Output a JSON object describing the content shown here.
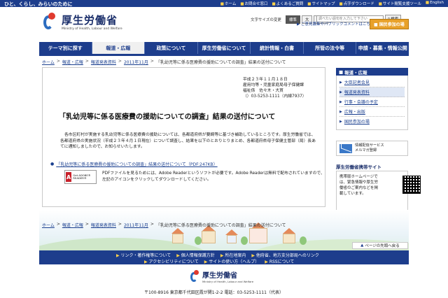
{
  "topbar": {
    "tagline": "ひと、くらし、みらいのために",
    "links": [
      "ホーム",
      "お問合せ窓口",
      "よくあるご質問",
      "サイトマップ",
      "点字ダウンロード",
      "サイト閲覧支援ツール",
      "English"
    ]
  },
  "header": {
    "logo_ja": "厚生労働省",
    "logo_en": "Ministry of Health, Labour and Welfare",
    "fontsize_label": "文字サイズの変更",
    "fontsize_options": [
      "標準",
      "大",
      "特大"
    ],
    "search_placeholder": "調べたい語句を入力して下さい",
    "search_button": "検索",
    "opinion_link": "ご意見募集やパブリックコメントはこちら",
    "join_button": "国民参加の場"
  },
  "gnav": [
    "テーマ別に探す",
    "報道・広報",
    "政策について",
    "厚生労働省について",
    "統計情報・白書",
    "所管の法令等",
    "申請・募集・情報公開"
  ],
  "breadcrumb": [
    "ホーム",
    "報道・広報",
    "報道発表資料",
    "2011年11月",
    "「乳幼児等に係る医療費の援助についての調査」結果の送付について"
  ],
  "breadcrumb_sep": ">",
  "article": {
    "info_lines": [
      "平成２３年１１月１８日",
      "雇用均等・児童家庭局母子保健課",
      "福祉係　佐々木・大貫",
      "（）03-5253-1111（内線7937）"
    ],
    "title": "「乳幼児等に係る医療費の援助についての調査」結果の送付について",
    "body": "各市区町村が実施する乳幼児等に係る医療費の援助については、各都道府県が要綱等に基づき補助しているところです。厚生労働省では、各都道府県の実施状況（平成２３年４月１日現在）について調査し、結果を以下のとおりとりまとめ、各都道府県母子保健主管部（局）長あてに通知しましたので、お知らせいたします。",
    "pdf_link": "「乳幼児等に係る医療費の援助についての調査」結果の送付について（PDF:247KB）",
    "adobe_text": "Get ADOBE® READER®",
    "adobe_note": "PDFファイルを見るためには、Adobe Readerというソフトが必要です。Adobe Readerは無料で配布されていますので、左記のアイコンをクリックしてダウンロードしてください。"
  },
  "sidebar": {
    "heading": "報道・広報",
    "items": [
      "大臣記者会見",
      "報道発表資料",
      "行事・会議の予定",
      "広報・出版",
      "国民参加の場"
    ],
    "mail_text": "情報配信サービス\nメルマガ登録",
    "mobile_heading": "厚生労働省携帯サイト",
    "mobile_text": "携帯版ホームページでは、緊急情報や厚生労働省のご案内などを掲載しています。"
  },
  "pagetop": "ページの先頭へ戻る",
  "footer": {
    "row1": [
      "リンク・著作権等について",
      "個人情報保護方針",
      "所在地案内",
      "他府省、地方支分部局へのリンク"
    ],
    "row2": [
      "アクセシビリティについて",
      "サイトの使い方（ヘルプ）",
      "RSSについて"
    ],
    "logo_ja": "厚生労働省",
    "logo_en": "Ministry of Health, Labour and Welfare",
    "address": "〒100-8916 東京都千代田区霞が関1-2-2 電話：03-5253-1111（代表）"
  }
}
